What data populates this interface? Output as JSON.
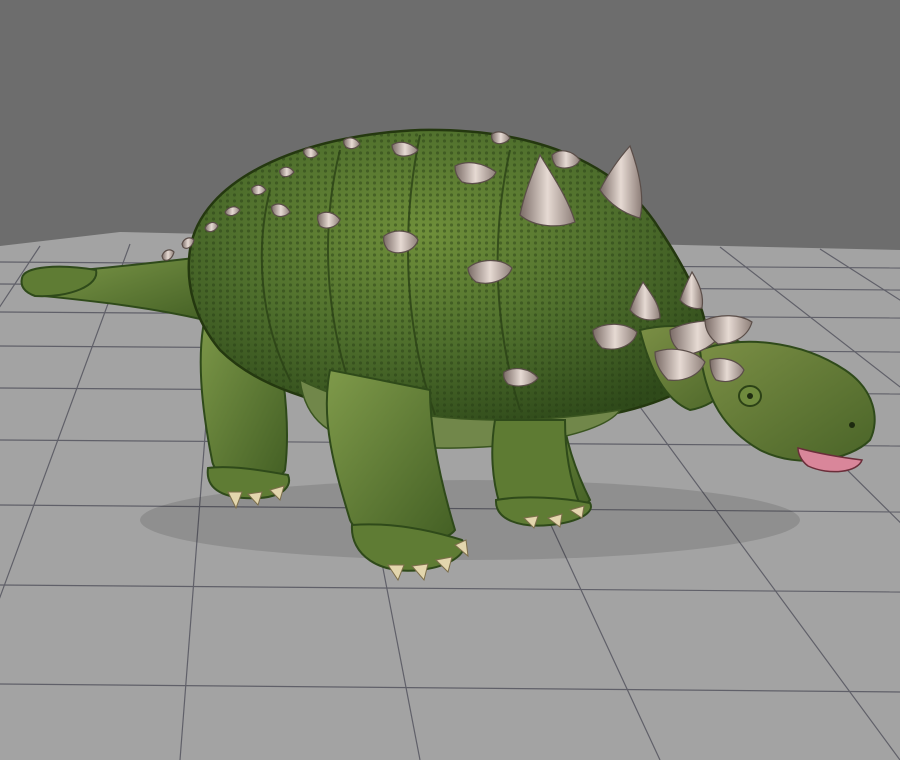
{
  "viewport": {
    "background_color": "#6d6d6d",
    "floor_color": "#a3a3a3",
    "grid_line_color": "#55555f"
  },
  "model": {
    "subject": "ankylosaur-3d-model",
    "skin_base_color": "#4e6e2c",
    "skin_dark_color": "#2f4a1a",
    "skin_light_color": "#7f9a4a",
    "belly_color": "#71874a",
    "spike_color": "#d8c9c2",
    "spike_shadow_color": "#7a6b66",
    "mouth_color": "#d9869a",
    "claw_color": "#e3d6ad"
  }
}
